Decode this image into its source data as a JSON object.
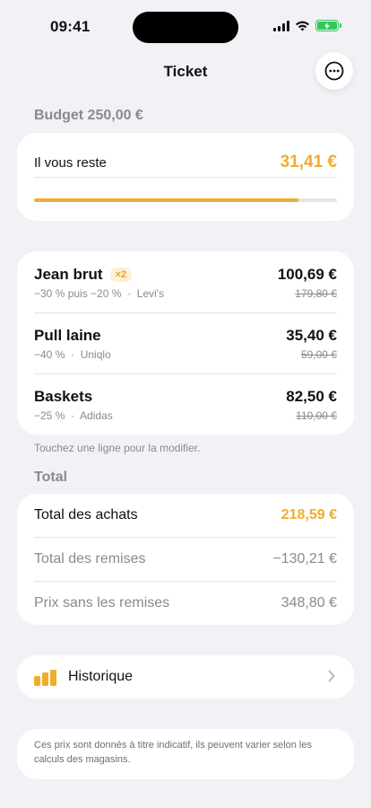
{
  "status_bar": {
    "time": "09:41"
  },
  "nav": {
    "title": "Ticket",
    "more_icon": "ellipsis-circle-icon"
  },
  "budget": {
    "label": "Budget 250,00 €",
    "remaining_label": "Il vous reste",
    "remaining_value": "31,41 €",
    "progress_fraction": 0.874,
    "accent_color": "#f0ad2b"
  },
  "items": [
    {
      "name": "Jean brut",
      "qty": "×2",
      "discount": "−30 % puis −20 %",
      "brand": "Levi's",
      "price": "100,69 €",
      "old_price": "179,80 €"
    },
    {
      "name": "Pull laine",
      "qty": "",
      "discount": "−40 %",
      "brand": "Uniqlo",
      "price": "35,40 €",
      "old_price": "59,00 €"
    },
    {
      "name": "Baskets",
      "qty": "",
      "discount": "−25 %",
      "brand": "Adidas",
      "price": "82,50 €",
      "old_price": "110,00 €"
    }
  ],
  "hint": "Touchez une ligne pour la modifier.",
  "totals": {
    "label": "Total",
    "rows": [
      {
        "label": "Total des achats",
        "value": "218,59 €"
      },
      {
        "label": "Total des remises",
        "value": "−130,21 €"
      },
      {
        "label": "Prix sans les remises",
        "value": "348,80 €"
      }
    ]
  },
  "history": {
    "label": "Historique",
    "icon": "bar-chart-icon"
  },
  "disclaimer": "Ces prix sont donnés à titre indicatif, ils peuvent varier selon les calculs des magasins."
}
